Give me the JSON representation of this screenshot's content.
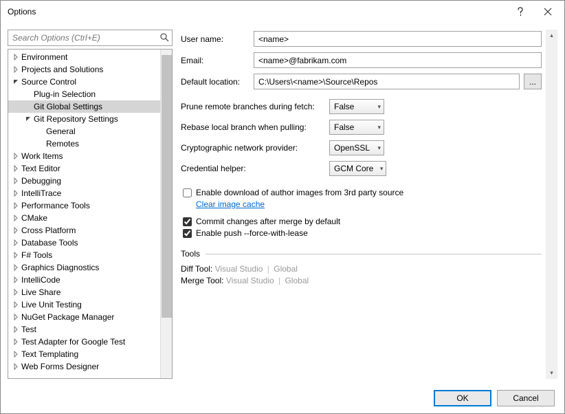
{
  "window": {
    "title": "Options"
  },
  "search": {
    "placeholder": "Search Options (Ctrl+E)"
  },
  "tree": [
    {
      "label": "Environment",
      "depth": 0,
      "state": "collapsed"
    },
    {
      "label": "Projects and Solutions",
      "depth": 0,
      "state": "collapsed"
    },
    {
      "label": "Source Control",
      "depth": 0,
      "state": "expanded"
    },
    {
      "label": "Plug-in Selection",
      "depth": 1,
      "state": "none"
    },
    {
      "label": "Git Global Settings",
      "depth": 1,
      "state": "none",
      "selected": true
    },
    {
      "label": "Git Repository Settings",
      "depth": 1,
      "state": "expanded"
    },
    {
      "label": "General",
      "depth": 2,
      "state": "none"
    },
    {
      "label": "Remotes",
      "depth": 2,
      "state": "none"
    },
    {
      "label": "Work Items",
      "depth": 0,
      "state": "collapsed"
    },
    {
      "label": "Text Editor",
      "depth": 0,
      "state": "collapsed"
    },
    {
      "label": "Debugging",
      "depth": 0,
      "state": "collapsed"
    },
    {
      "label": "IntelliTrace",
      "depth": 0,
      "state": "collapsed"
    },
    {
      "label": "Performance Tools",
      "depth": 0,
      "state": "collapsed"
    },
    {
      "label": "CMake",
      "depth": 0,
      "state": "collapsed"
    },
    {
      "label": "Cross Platform",
      "depth": 0,
      "state": "collapsed"
    },
    {
      "label": "Database Tools",
      "depth": 0,
      "state": "collapsed"
    },
    {
      "label": "F# Tools",
      "depth": 0,
      "state": "collapsed"
    },
    {
      "label": "Graphics Diagnostics",
      "depth": 0,
      "state": "collapsed"
    },
    {
      "label": "IntelliCode",
      "depth": 0,
      "state": "collapsed"
    },
    {
      "label": "Live Share",
      "depth": 0,
      "state": "collapsed"
    },
    {
      "label": "Live Unit Testing",
      "depth": 0,
      "state": "collapsed"
    },
    {
      "label": "NuGet Package Manager",
      "depth": 0,
      "state": "collapsed"
    },
    {
      "label": "Test",
      "depth": 0,
      "state": "collapsed"
    },
    {
      "label": "Test Adapter for Google Test",
      "depth": 0,
      "state": "collapsed"
    },
    {
      "label": "Text Templating",
      "depth": 0,
      "state": "collapsed"
    },
    {
      "label": "Web Forms Designer",
      "depth": 0,
      "state": "collapsed"
    }
  ],
  "fields": {
    "username_label": "User name:",
    "username_value": "<name>",
    "email_label": "Email:",
    "email_value": "<name>@fabrikam.com",
    "location_label": "Default location:",
    "location_value": "C:\\Users\\<name>\\Source\\Repos",
    "browse_label": "..."
  },
  "options": {
    "prune_label": "Prune remote branches during fetch:",
    "prune_value": "False",
    "rebase_label": "Rebase local branch when pulling:",
    "rebase_value": "False",
    "crypto_label": "Cryptographic network provider:",
    "crypto_value": "OpenSSL",
    "cred_label": "Credential helper:",
    "cred_value": "GCM Core"
  },
  "checks": {
    "enable_images_label": "Enable download of author images from 3rd party source",
    "enable_images_checked": false,
    "clear_cache_link": "Clear image cache",
    "commit_merge_label": "Commit changes after merge by default",
    "commit_merge_checked": true,
    "force_lease_label": "Enable push --force-with-lease",
    "force_lease_checked": true
  },
  "tools": {
    "section_label": "Tools",
    "diff_label": "Diff Tool:",
    "merge_label": "Merge Tool:",
    "opt_vs": "Visual Studio",
    "opt_global": "Global"
  },
  "footer": {
    "ok": "OK",
    "cancel": "Cancel"
  }
}
